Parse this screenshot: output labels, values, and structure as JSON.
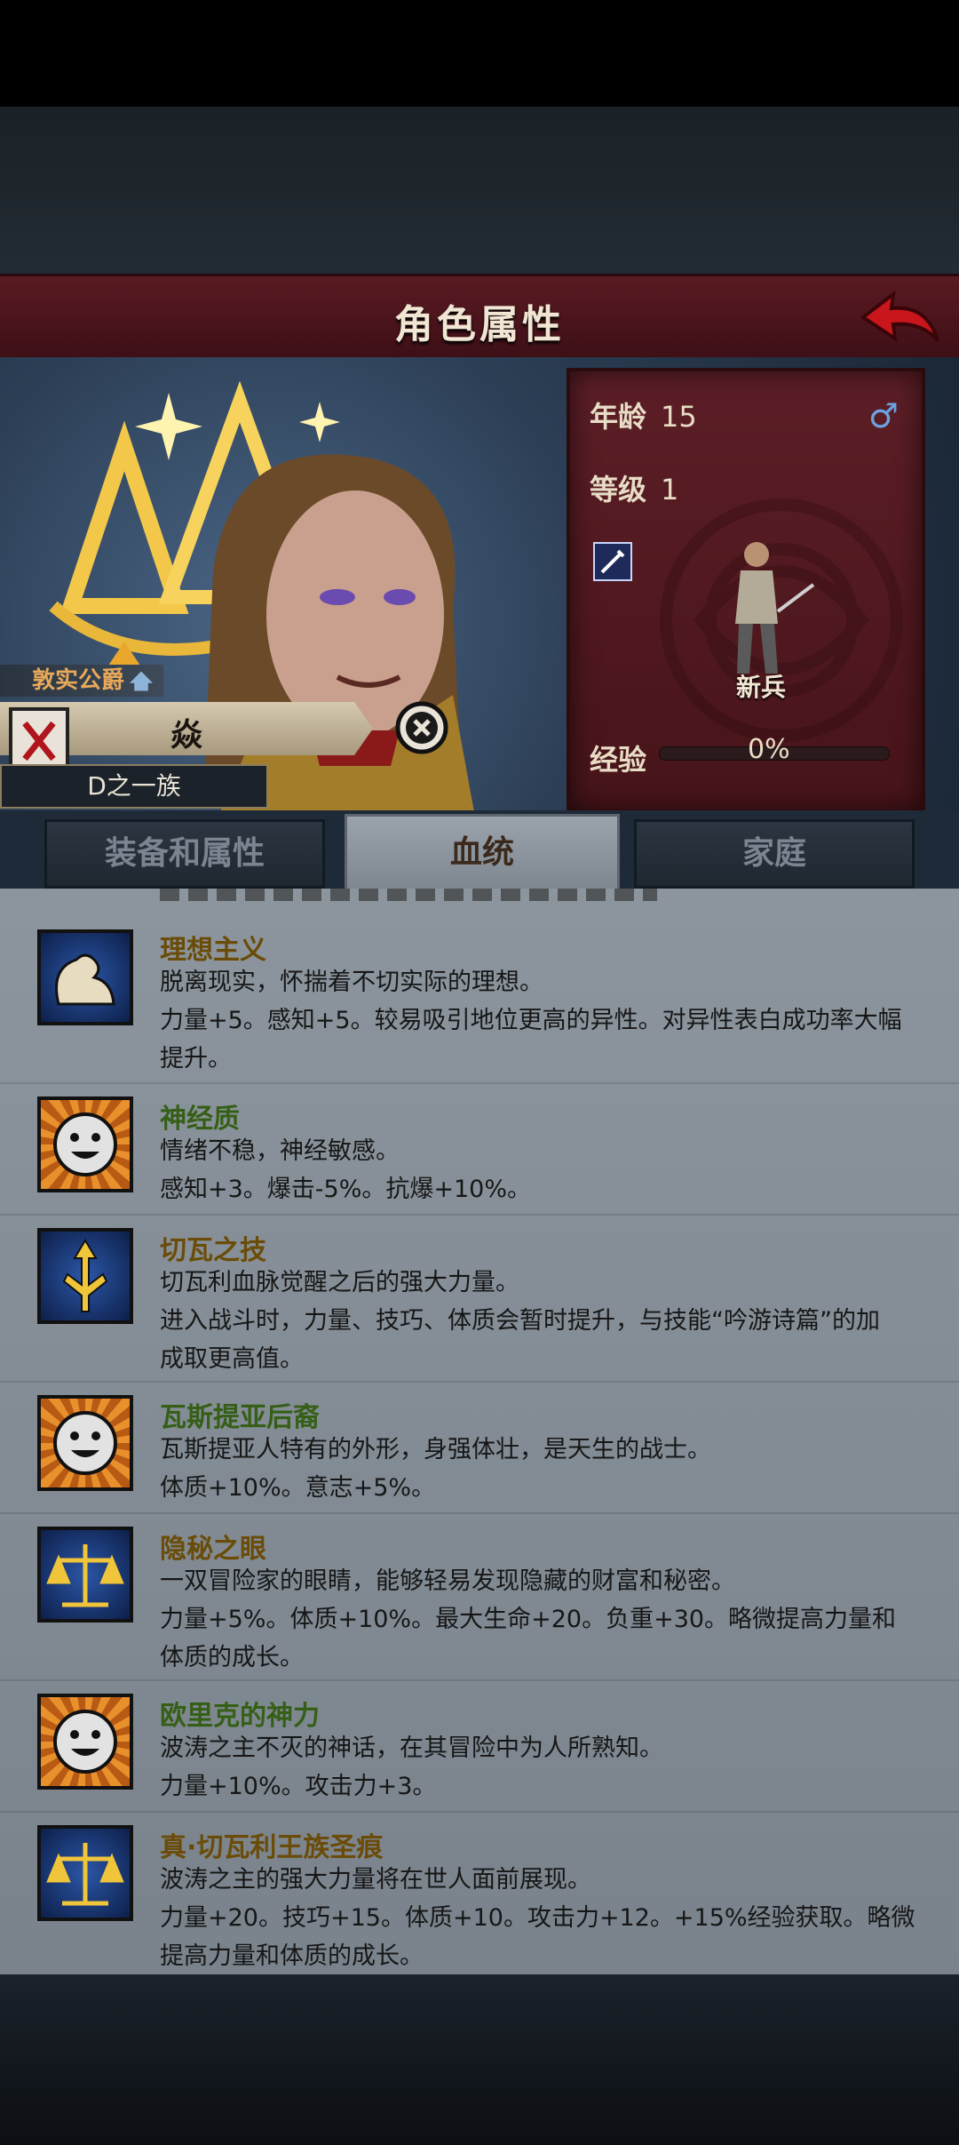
{
  "header": {
    "title": "角色属性"
  },
  "hero": {
    "title": "敦实公爵",
    "name": "焱",
    "clan": "D之一族"
  },
  "stats": {
    "age_label": "年龄",
    "age": "15",
    "gender_symbol": "♂",
    "level_label": "等级",
    "level": "1",
    "unit_name": "新兵",
    "exp_label": "经验",
    "exp_pct": "0%",
    "exp_fraction": 0.0
  },
  "tabs": [
    {
      "label": "装备和属性"
    },
    {
      "label": "血统"
    },
    {
      "label": "家庭"
    }
  ],
  "traits": [
    {
      "name": "理想主义",
      "icon": "flexed-arm-icon",
      "desc1": "脱离现实，怀揣着不切实际的理想。",
      "desc2": "力量+5。感知+5。较易吸引地位更高的异性。对异性表白成功率大幅",
      "desc3": "提升。"
    },
    {
      "name": "神经质",
      "icon": "smiley-face-icon",
      "desc1": "情绪不稳，神经敏感。",
      "desc2": "感知+3。爆击-5%。抗爆+10%。"
    },
    {
      "name": "切瓦之技",
      "icon": "golden-sword-icon",
      "desc1": "切瓦利血脉觉醒之后的强大力量。",
      "desc2": "进入战斗时，力量、技巧、体质会暂时提升，与技能“吟游诗篇”的加",
      "desc3": "成取更高值。"
    },
    {
      "name": "瓦斯提亚后裔",
      "icon": "smiley-face-icon",
      "desc1": "瓦斯提亚人特有的外形，身强体壮，是天生的战士。",
      "desc2": "体质+10%。意志+5%。"
    },
    {
      "name": "隐秘之眼",
      "icon": "scales-icon",
      "desc1": "一双冒险家的眼睛，能够轻易发现隐藏的财富和秘密。",
      "desc2": "力量+5%。体质+10%。最大生命+20。负重+30。略微提高力量和",
      "desc3": "体质的成长。"
    },
    {
      "name": "欧里克的神力",
      "icon": "smiley-face-icon",
      "desc1": "波涛之主不灭的神话，在其冒险中为人所熟知。",
      "desc2": "力量+10%。攻击力+3。"
    },
    {
      "name": "真·切瓦利王族圣痕",
      "icon": "scales-icon",
      "desc1": "波涛之主的强大力量将在世人面前展现。",
      "desc2": "力量+20。技巧+15。体质+10。攻击力+12。+15%经验获取。略微",
      "desc3": "提高力量和体质的成长。"
    }
  ]
}
